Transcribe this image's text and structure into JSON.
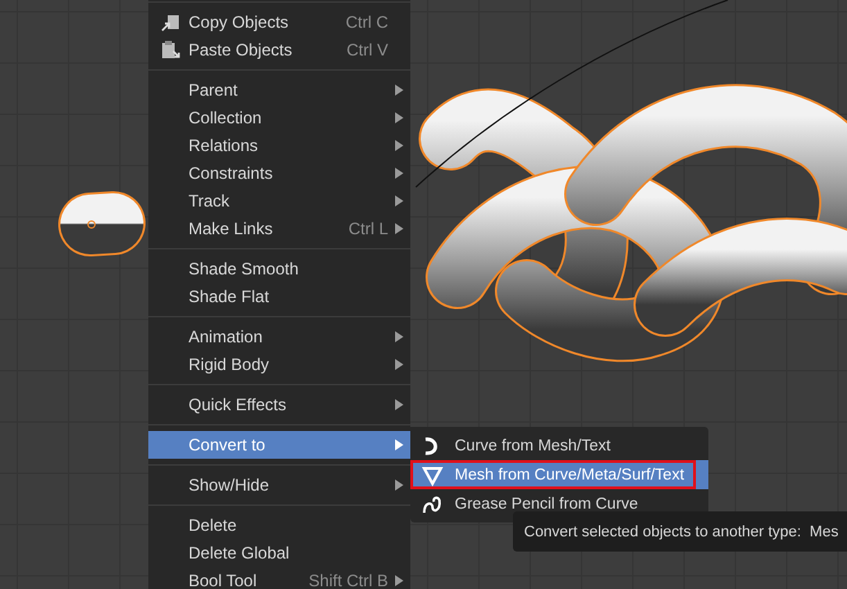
{
  "context_menu": {
    "sections": [
      {
        "items": [
          {
            "label": "Copy Objects",
            "shortcut": "Ctrl C",
            "submenu": false,
            "selected": false
          },
          {
            "label": "Paste Objects",
            "shortcut": "Ctrl V",
            "submenu": false,
            "selected": false
          }
        ]
      },
      {
        "items": [
          {
            "label": "Parent",
            "submenu": true,
            "selected": false
          },
          {
            "label": "Collection",
            "submenu": true,
            "selected": false
          },
          {
            "label": "Relations",
            "submenu": true,
            "selected": false
          },
          {
            "label": "Constraints",
            "submenu": true,
            "selected": false
          },
          {
            "label": "Track",
            "submenu": true,
            "selected": false
          },
          {
            "label": "Make Links",
            "shortcut": "Ctrl L",
            "submenu": true,
            "selected": false
          }
        ]
      },
      {
        "items": [
          {
            "label": "Shade Smooth",
            "submenu": false,
            "selected": false
          },
          {
            "label": "Shade Flat",
            "submenu": false,
            "selected": false
          }
        ]
      },
      {
        "items": [
          {
            "label": "Animation",
            "submenu": true,
            "selected": false
          },
          {
            "label": "Rigid Body",
            "submenu": true,
            "selected": false
          }
        ]
      },
      {
        "items": [
          {
            "label": "Quick Effects",
            "submenu": true,
            "selected": false
          }
        ]
      },
      {
        "items": [
          {
            "label": "Convert to",
            "submenu": true,
            "selected": true
          }
        ]
      },
      {
        "items": [
          {
            "label": "Show/Hide",
            "submenu": true,
            "selected": false
          }
        ]
      },
      {
        "items": [
          {
            "label": "Delete",
            "submenu": false,
            "selected": false
          },
          {
            "label": "Delete Global",
            "submenu": false,
            "selected": false
          },
          {
            "label": "Bool Tool",
            "shortcut": "Shift Ctrl B",
            "submenu": true,
            "selected": false
          }
        ]
      }
    ]
  },
  "submenu": {
    "items": [
      {
        "label": "Curve from Mesh/Text",
        "selected": false,
        "outlined": false
      },
      {
        "label": "Mesh from Curve/Meta/Surf/Text",
        "selected": true,
        "outlined": true
      },
      {
        "label": "Grease Pencil from Curve",
        "selected": false,
        "outlined": false
      }
    ]
  },
  "tooltip": {
    "text": "Convert selected objects to another type:  Mes"
  }
}
